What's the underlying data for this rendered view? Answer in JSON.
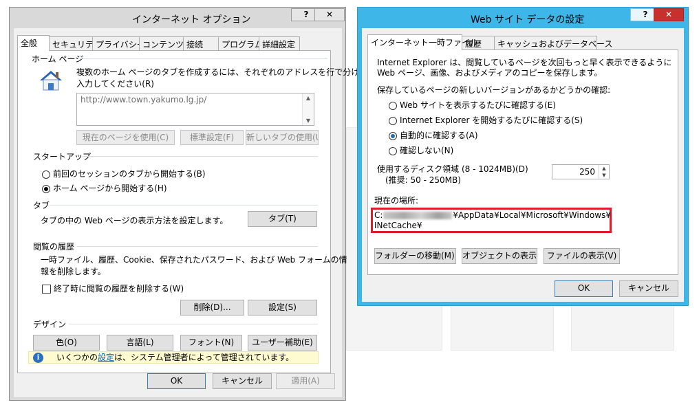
{
  "internet_options": {
    "title": "インターネット オプション",
    "help_label": "?",
    "close_label": "✕",
    "tabs": [
      "全般",
      "セキュリティ",
      "プライバシー",
      "コンテンツ",
      "接続",
      "プログラム",
      "詳細設定"
    ],
    "home_page": {
      "group_label": "ホーム ページ",
      "description_line1": "複数のホーム ページのタブを作成するには、それぞれのアドレスを行で分けて",
      "description_line2": "入力してください(R)",
      "url": "http://www.town.yakumo.lg.jp/",
      "btn_use_current": "現在のページを使用(C)",
      "btn_default": "標準設定(F)",
      "btn_new_tab": "新しいタブの使用(U)"
    },
    "startup": {
      "group_label": "スタートアップ",
      "option_previous": "前回のセッションのタブから開始する(B)",
      "option_home": "ホーム ページから開始する(H)"
    },
    "tabs_section": {
      "group_label": "タブ",
      "description": "タブの中の Web ページの表示方法を設定します。",
      "btn_tabs": "タブ(T)"
    },
    "history": {
      "group_label": "閲覧の履歴",
      "description_line1": "一時ファイル、履歴、Cookie、保存されたパスワード、および Web フォームの情",
      "description_line2": "報を削除します。",
      "checkbox_delete_on_exit": "終了時に閲覧の履歴を削除する(W)",
      "btn_delete": "削除(D)...",
      "btn_settings": "設定(S)"
    },
    "design": {
      "group_label": "デザイン",
      "btn_colors": "色(O)",
      "btn_languages": "言語(L)",
      "btn_fonts": "フォント(N)",
      "btn_accessibility": "ユーザー補助(E)"
    },
    "info": {
      "icon": "info-icon",
      "text_before": "いくつかの",
      "link": "設定",
      "text_after": "は、システム管理者によって管理されています。"
    },
    "footer": {
      "ok": "OK",
      "cancel": "キャンセル",
      "apply": "適用(A)"
    }
  },
  "website_data_settings": {
    "title": "Web サイト データの設定",
    "help_label": "?",
    "close_label": "✕",
    "tabs": [
      "インターネット一時ファイル",
      "履歴",
      "キャッシュおよびデータベース"
    ],
    "description_line1": "Internet Explorer は、閲覧しているページを次回もっと早く表示できるように",
    "description_line2": "Web ページ、画像、およびメディアのコピーを保存します。",
    "check_label": "保存しているページの新しいバージョンがあるかどうかの確認:",
    "options": [
      "Web サイトを表示するたびに確認する(E)",
      "Internet Explorer を開始するたびに確認する(S)",
      "自動的に確認する(A)",
      "確認しない(N)"
    ],
    "selected_option": 2,
    "disk_space_label": "使用するディスク領域 (8 - 1024MB)(D)",
    "disk_space_recommended": "(推奨: 50 - 250MB)",
    "disk_space_value": "250",
    "current_location_label": "現在の場所:",
    "path_prefix": "C:",
    "path_suffix": "¥AppData¥Local¥Microsoft¥Windows¥",
    "path_line2": "INetCache¥",
    "btn_move_folder": "フォルダーの移動(M)...",
    "btn_view_objects": "オブジェクトの表示(O)",
    "btn_view_files": "ファイルの表示(V)",
    "footer": {
      "ok": "OK",
      "cancel": "キャンセル"
    }
  },
  "colors": {
    "accent_title": "#3fb6e8",
    "highlight_red": "#e21b2a",
    "close_red": "#c7302c"
  }
}
